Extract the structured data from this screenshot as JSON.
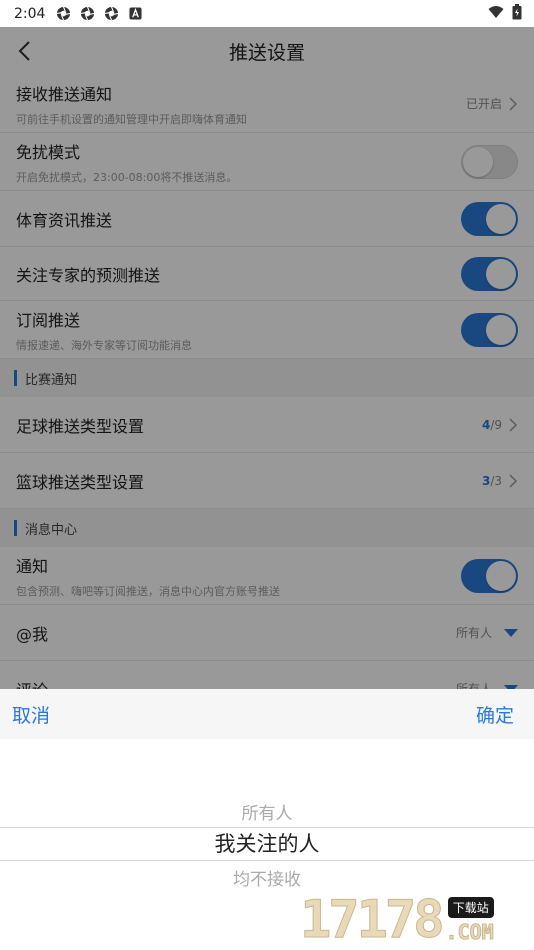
{
  "status_bar": {
    "time": "2:04",
    "icons": [
      "aperture-icon",
      "aperture-icon",
      "aperture-icon",
      "a-badge-icon"
    ],
    "right_icons": [
      "wifi-icon",
      "battery-icon"
    ]
  },
  "nav": {
    "title": "推送设置",
    "back_icon": "chevron-left-icon"
  },
  "settings": {
    "receive": {
      "label": "接收推送通知",
      "sub": "可前往手机设置的通知管理中开启即嗨体育通知",
      "status": "已开启"
    },
    "dnd": {
      "label": "免扰模式",
      "sub": "开启免扰模式，23:00-08:00将不推送消息。",
      "on": false
    },
    "sports_news": {
      "label": "体育资讯推送",
      "on": true
    },
    "expert": {
      "label": "关注专家的预测推送",
      "on": true
    },
    "subscribe": {
      "label": "订阅推送",
      "sub": "情报速递、海外专家等订阅功能消息",
      "on": true
    }
  },
  "match_section": {
    "title": "比赛通知"
  },
  "football": {
    "label": "足球推送类型设置",
    "current": "4",
    "total": "/9"
  },
  "basketball": {
    "label": "篮球推送类型设置",
    "current": "3",
    "total": "/3"
  },
  "message_section": {
    "title": "消息中心"
  },
  "notify": {
    "label": "通知",
    "sub": "包含预测、嗨吧等订阅推送，消息中心内官方账号推送",
    "on": true
  },
  "mention": {
    "label": "@我",
    "value": "所有人"
  },
  "comment": {
    "label": "评论",
    "value": "所有人"
  },
  "picker": {
    "cancel": "取消",
    "confirm": "确定",
    "options": [
      "所有人",
      "我关注的人",
      "均不接收"
    ],
    "selected": "我关注的人"
  },
  "watermark": {
    "number": "17178",
    "tag": "下载站",
    "domain": ".COM"
  },
  "colors": {
    "accent": "#2b78d6",
    "overlay": "rgba(0,0,0,0.40)"
  }
}
